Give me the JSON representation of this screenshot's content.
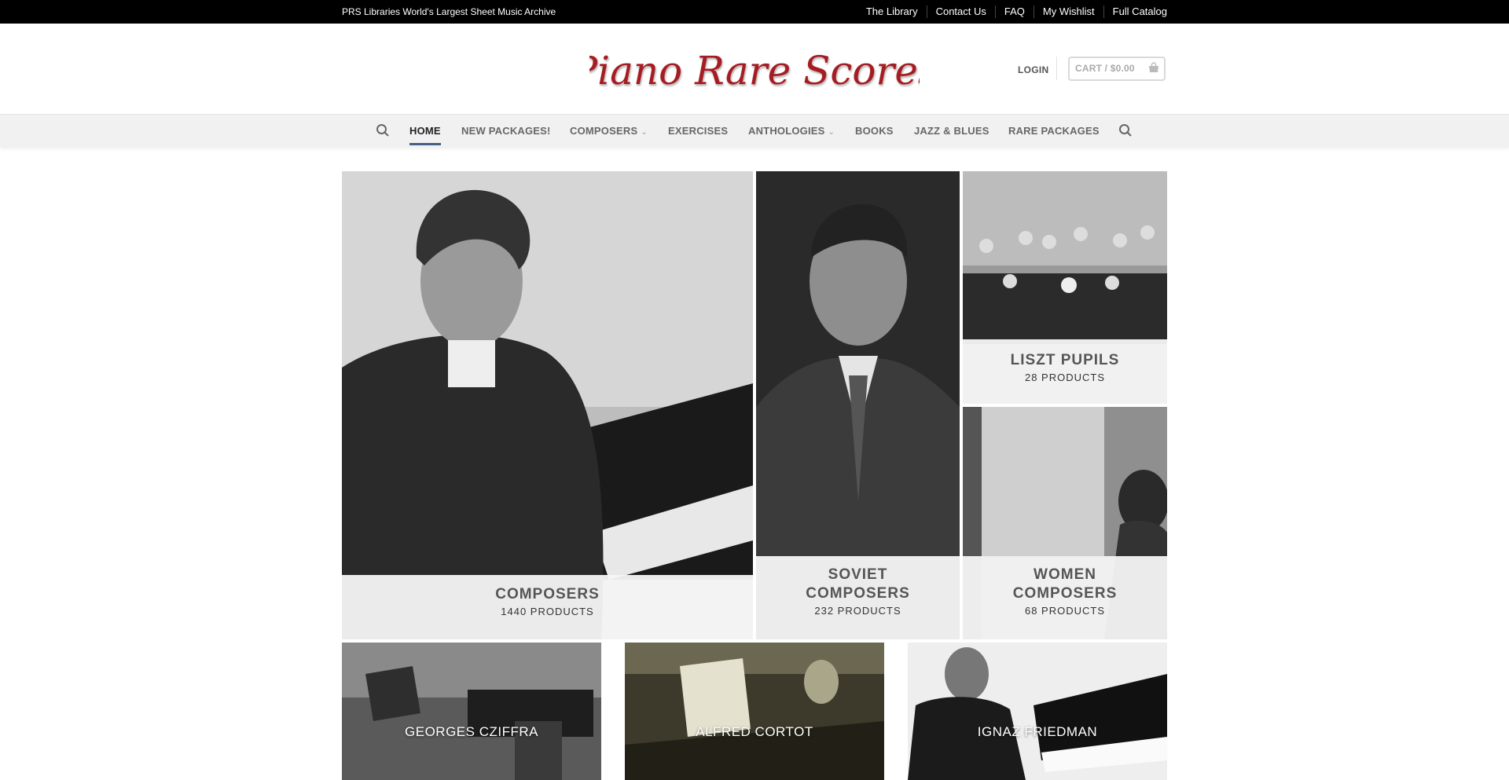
{
  "topbar": {
    "tagline": "PRS Libraries World's Largest Sheet Music Archive",
    "links": [
      "The Library",
      "Contact Us",
      "FAQ",
      "My Wishlist",
      "Full Catalog"
    ]
  },
  "header": {
    "logo_text": "Piano Rare Scores",
    "login": "LOGIN",
    "cart": "CART / $0.00"
  },
  "nav": {
    "items": [
      "HOME",
      "NEW PACKAGES!",
      "COMPOSERS",
      "EXERCISES",
      "ANTHOLOGIES",
      "BOOKS",
      "JAZZ & BLUES",
      "RARE PACKAGES"
    ],
    "active": "HOME"
  },
  "categories": [
    {
      "title": "COMPOSERS",
      "count": "1440 PRODUCTS"
    },
    {
      "title_line1": "SOVIET",
      "title_line2": "COMPOSERS",
      "count": "232 PRODUCTS"
    },
    {
      "title": "LISZT PUPILS",
      "count": "28 PRODUCTS"
    },
    {
      "title_line1": "WOMEN",
      "title_line2": "COMPOSERS",
      "count": "68 PRODUCTS"
    }
  ],
  "featured": [
    "GEORGES CZIFFRA",
    "ALFRED CORTOT",
    "IGNAZ FRIEDMAN"
  ],
  "colors": {
    "accent": "#446084",
    "logo": "#a51c22",
    "topbar": "#000000"
  }
}
